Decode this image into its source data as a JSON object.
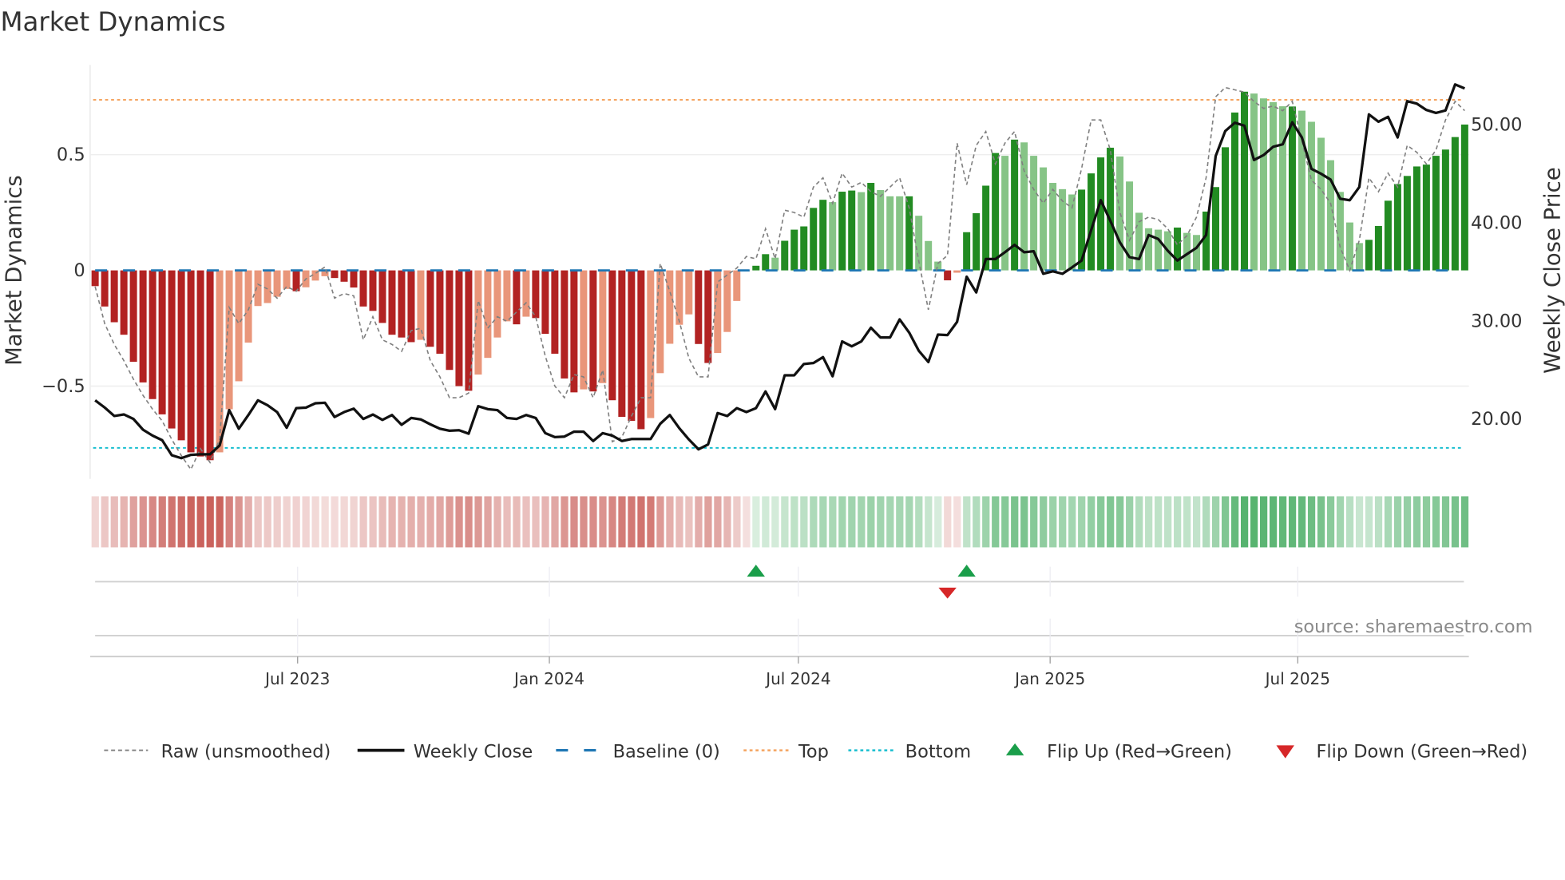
{
  "chart_data": {
    "type": "bar",
    "title": "Market Dynamics",
    "ylabel": "Market Dynamics",
    "ylabel_right": "Weekly Close Price",
    "xlabel": "",
    "x_start": "2023-02-03",
    "x_step_days": 7,
    "ylim": [
      -0.88,
      0.88
    ],
    "ylim_right": [
      12.5,
      56
    ],
    "y_ticks": [
      {
        "value": 0.5,
        "label": "0.5"
      },
      {
        "value": 0,
        "label": "0"
      },
      {
        "value": -0.5,
        "label": "−0.5"
      }
    ],
    "y_right_ticks": [
      {
        "value": 50,
        "label": "50.00"
      },
      {
        "value": 40,
        "label": "40.00"
      },
      {
        "value": 30,
        "label": "30.00"
      },
      {
        "value": 20,
        "label": "20.00"
      }
    ],
    "x_ticks": [
      {
        "date": "2023-07-01",
        "label": "Jul 2023"
      },
      {
        "date": "2024-01-01",
        "label": "Jan 2024"
      },
      {
        "date": "2024-07-01",
        "label": "Jul 2024"
      },
      {
        "date": "2025-01-01",
        "label": "Jan 2025"
      },
      {
        "date": "2025-07-01",
        "label": "Jul 2025"
      }
    ],
    "top_level": 0.737,
    "bottom_level": -0.767,
    "baseline": 0,
    "series": [
      {
        "name": "Market Dynamics",
        "kind": "bar",
        "values": [
          -0.068,
          -0.156,
          -0.224,
          -0.278,
          -0.395,
          -0.484,
          -0.556,
          -0.622,
          -0.683,
          -0.734,
          -0.786,
          -0.804,
          -0.82,
          -0.786,
          -0.6,
          -0.479,
          -0.312,
          -0.154,
          -0.141,
          -0.114,
          -0.08,
          -0.09,
          -0.073,
          -0.044,
          -0.025,
          -0.033,
          -0.049,
          -0.074,
          -0.156,
          -0.175,
          -0.227,
          -0.278,
          -0.29,
          -0.31,
          -0.3,
          -0.33,
          -0.36,
          -0.43,
          -0.5,
          -0.52,
          -0.45,
          -0.378,
          -0.29,
          -0.22,
          -0.233,
          -0.2,
          -0.206,
          -0.274,
          -0.36,
          -0.467,
          -0.527,
          -0.514,
          -0.523,
          -0.487,
          -0.561,
          -0.633,
          -0.65,
          -0.686,
          -0.638,
          -0.444,
          -0.317,
          -0.235,
          -0.19,
          -0.318,
          -0.4,
          -0.357,
          -0.266,
          -0.132,
          -0.003,
          0.02,
          0.07,
          0.055,
          0.128,
          0.176,
          0.19,
          0.27,
          0.305,
          0.295,
          0.34,
          0.345,
          0.338,
          0.378,
          0.347,
          0.32,
          0.32,
          0.32,
          0.236,
          0.127,
          0.038,
          -0.043,
          -0.01,
          0.165,
          0.247,
          0.366,
          0.507,
          0.495,
          0.565,
          0.553,
          0.495,
          0.445,
          0.378,
          0.351,
          0.328,
          0.349,
          0.419,
          0.488,
          0.53,
          0.492,
          0.384,
          0.249,
          0.182,
          0.176,
          0.169,
          0.185,
          0.162,
          0.153,
          0.254,
          0.36,
          0.532,
          0.682,
          0.772,
          0.764,
          0.743,
          0.727,
          0.709,
          0.708,
          0.69,
          0.642,
          0.573,
          0.476,
          0.339,
          0.207,
          0.118,
          0.132,
          0.192,
          0.301,
          0.373,
          0.408,
          0.449,
          0.457,
          0.495,
          0.522,
          0.576,
          0.63
        ],
        "strong": [
          1,
          1,
          1,
          1,
          1,
          1,
          1,
          1,
          1,
          1,
          1,
          1,
          1,
          0,
          0,
          0,
          0,
          0,
          0,
          0,
          0,
          1,
          0,
          0,
          0,
          1,
          1,
          1,
          1,
          1,
          1,
          1,
          1,
          1,
          0,
          1,
          1,
          1,
          1,
          1,
          0,
          0,
          0,
          0,
          1,
          0,
          1,
          1,
          1,
          1,
          1,
          0,
          1,
          0,
          1,
          1,
          1,
          1,
          0,
          0,
          0,
          0,
          0,
          1,
          1,
          0,
          0,
          0,
          0,
          1,
          1,
          0,
          1,
          1,
          1,
          1,
          1,
          0,
          1,
          1,
          0,
          1,
          0,
          0,
          0,
          1,
          0,
          0,
          0,
          1,
          0,
          1,
          1,
          1,
          1,
          0,
          1,
          0,
          0,
          0,
          0,
          0,
          0,
          1,
          1,
          1,
          1,
          0,
          0,
          0,
          0,
          0,
          0,
          1,
          0,
          0,
          1,
          1,
          1,
          1,
          1,
          0,
          0,
          0,
          0,
          1,
          0,
          0,
          0,
          0,
          0,
          0,
          0,
          1,
          1,
          1,
          1,
          1,
          1,
          1,
          1,
          1,
          1,
          1
        ]
      },
      {
        "name": "Raw (unsmoothed)",
        "kind": "line",
        "values": [
          -0.07,
          -0.23,
          -0.32,
          -0.39,
          -0.47,
          -0.54,
          -0.6,
          -0.65,
          -0.73,
          -0.8,
          -0.86,
          -0.77,
          -0.83,
          -0.73,
          -0.16,
          -0.23,
          -0.17,
          -0.06,
          -0.08,
          -0.12,
          -0.07,
          -0.09,
          -0.037,
          -0.013,
          0.015,
          -0.12,
          -0.1,
          -0.11,
          -0.3,
          -0.2,
          -0.3,
          -0.32,
          -0.35,
          -0.26,
          -0.25,
          -0.39,
          -0.46,
          -0.55,
          -0.55,
          -0.53,
          -0.13,
          -0.25,
          -0.2,
          -0.22,
          -0.18,
          -0.14,
          -0.2,
          -0.37,
          -0.5,
          -0.55,
          -0.45,
          -0.46,
          -0.55,
          -0.43,
          -0.74,
          -0.72,
          -0.63,
          -0.55,
          -0.55,
          0.03,
          -0.09,
          -0.22,
          -0.38,
          -0.46,
          -0.46,
          -0.05,
          -0.02,
          0.01,
          0.06,
          0.05,
          0.18,
          0.05,
          0.26,
          0.25,
          0.23,
          0.36,
          0.4,
          0.29,
          0.42,
          0.36,
          0.38,
          0.34,
          0.32,
          0.36,
          0.4,
          0.27,
          0.04,
          -0.17,
          0.03,
          0.065,
          0.55,
          0.37,
          0.54,
          0.6,
          0.46,
          0.55,
          0.6,
          0.43,
          0.35,
          0.29,
          0.35,
          0.3,
          0.27,
          0.44,
          0.65,
          0.65,
          0.52,
          0.25,
          0.13,
          0.21,
          0.23,
          0.22,
          0.18,
          0.11,
          0.15,
          0.23,
          0.4,
          0.75,
          0.79,
          0.78,
          0.77,
          0.73,
          0.7,
          0.71,
          0.69,
          0.73,
          0.56,
          0.39,
          0.35,
          0.29,
          0.1,
          0.0,
          0.13,
          0.4,
          0.34,
          0.42,
          0.36,
          0.54,
          0.51,
          0.46,
          0.52,
          0.65,
          0.73,
          0.69
        ]
      },
      {
        "name": "Weekly Close",
        "kind": "line",
        "axis": "right",
        "values": [
          21.8,
          21.06,
          20.2,
          20.36,
          19.9,
          18.8,
          18.2,
          17.73,
          16.2,
          15.9,
          16.24,
          16.3,
          16.3,
          17.2,
          20.8,
          18.9,
          20.3,
          21.8,
          21.3,
          20.6,
          19.0,
          21.0,
          21.05,
          21.5,
          21.55,
          20.1,
          20.6,
          20.95,
          19.9,
          20.35,
          19.8,
          20.3,
          19.3,
          20.0,
          19.85,
          19.35,
          18.9,
          18.7,
          18.75,
          18.4,
          21.2,
          20.9,
          20.8,
          20.0,
          19.9,
          20.3,
          20.0,
          18.45,
          18.05,
          18.1,
          18.6,
          18.6,
          17.65,
          18.45,
          18.2,
          17.65,
          17.85,
          17.85,
          17.85,
          19.4,
          20.3,
          18.95,
          17.8,
          16.8,
          17.3,
          20.5,
          20.2,
          21.0,
          20.6,
          21.0,
          22.7,
          20.9,
          24.35,
          24.35,
          25.5,
          25.6,
          26.2,
          24.25,
          27.8,
          27.3,
          27.8,
          29.2,
          28.2,
          28.2,
          30.05,
          28.7,
          26.85,
          25.7,
          28.5,
          28.45,
          29.8,
          34.4,
          32.8,
          36.2,
          36.2,
          36.9,
          37.65,
          36.9,
          37.0,
          34.7,
          34.95,
          34.7,
          35.35,
          36.05,
          39.15,
          42.2,
          40.1,
          37.9,
          36.4,
          36.2,
          38.65,
          38.25,
          37.05,
          36.05,
          36.7,
          37.35,
          38.65,
          46.7,
          49.25,
          50.1,
          49.8,
          46.3,
          46.8,
          47.65,
          47.9,
          50.15,
          48.6,
          45.4,
          44.9,
          44.3,
          42.35,
          42.2,
          43.55,
          50.95,
          50.2,
          50.7,
          48.6,
          52.3,
          52.05,
          51.4,
          51.1,
          51.35,
          54.0,
          53.6
        ]
      }
    ],
    "flips": {
      "up": [
        "2024-05-31",
        "2024-11-01"
      ],
      "down": [
        "2024-10-18"
      ]
    },
    "legend": {
      "placement": "bottom",
      "items": [
        {
          "label": "Raw (unsmoothed)"
        },
        {
          "label": "Weekly Close"
        },
        {
          "label": "Baseline (0)"
        },
        {
          "label": "Top"
        },
        {
          "label": "Bottom"
        },
        {
          "label": "Flip Up (Red→Green)"
        },
        {
          "label": "Flip Down (Green→Red)"
        }
      ]
    },
    "source": "source: sharemaestro.com",
    "grid": true
  },
  "colors": {
    "red_strong": "#b22222",
    "red_weak": "#e9967a",
    "green_strong": "#228b22",
    "green_weak": "#86c486",
    "strip_red": "#c4504a",
    "strip_green": "#3ea85a",
    "raw": "#808080",
    "close": "#111111",
    "baseline": "#1f77b4",
    "top": "#f4a460",
    "bottom": "#17becf",
    "flip_up": "#1a9e4a",
    "flip_down": "#d62728"
  }
}
